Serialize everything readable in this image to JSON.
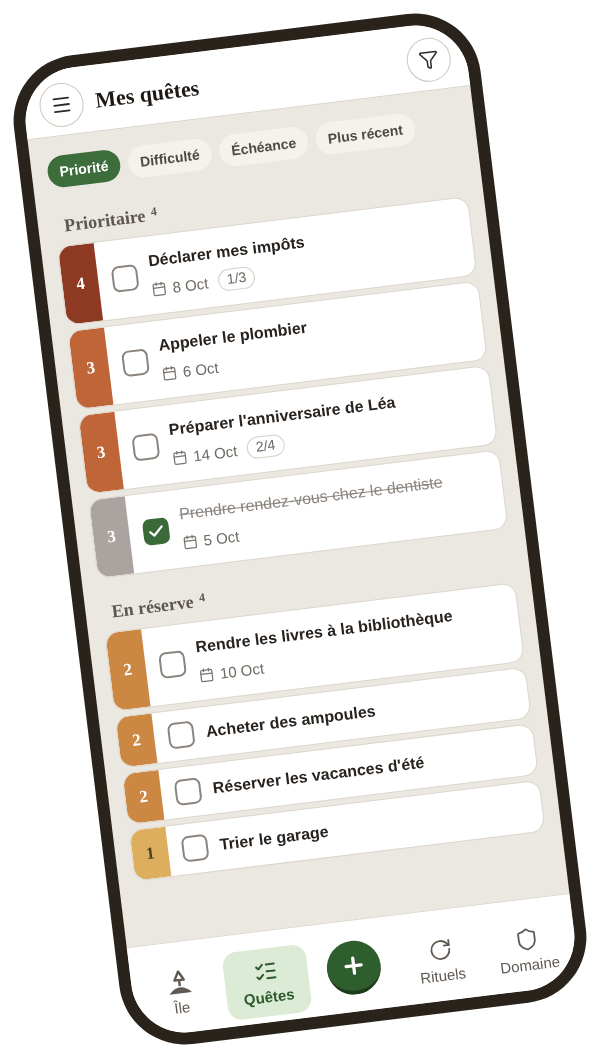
{
  "header": {
    "title": "Mes quêtes"
  },
  "sort_chips": [
    {
      "label": "Priorité",
      "selected": true
    },
    {
      "label": "Difficulté",
      "selected": false
    },
    {
      "label": "Échéance",
      "selected": false
    },
    {
      "label": "Plus récent",
      "selected": false
    }
  ],
  "sections": [
    {
      "title": "Prioritaire",
      "count": "4",
      "quests": [
        {
          "priority": "4",
          "color": "#8e3a22",
          "title": "Déclarer mes impôts",
          "done": false,
          "date": "8 Oct",
          "subtasks": "1/3"
        },
        {
          "priority": "3",
          "color": "#c06537",
          "title": "Appeler le plombier",
          "done": false,
          "date": "6 Oct"
        },
        {
          "priority": "3",
          "color": "#c06537",
          "title": "Préparer l'anniversaire de Léa",
          "done": false,
          "date": "14 Oct",
          "subtasks": "2/4"
        },
        {
          "priority": "3",
          "color": "#aaa3a0",
          "title": "Prendre rendez-vous chez le dentiste",
          "done": true,
          "date": "5 Oct"
        }
      ]
    },
    {
      "title": "En réserve",
      "count": "4",
      "quests": [
        {
          "priority": "2",
          "color": "#cc8743",
          "title": "Rendre les livres à la bibliothèque",
          "done": false,
          "date": "10 Oct"
        },
        {
          "priority": "2",
          "color": "#cc8743",
          "title": "Acheter des ampoules",
          "done": false
        },
        {
          "priority": "2",
          "color": "#cc8743",
          "title": "Réserver les vacances d'été",
          "done": false
        },
        {
          "priority": "1",
          "color": "#dcae5e",
          "title": "Trier le garage",
          "done": false
        }
      ]
    }
  ],
  "nav": [
    {
      "kind": "island",
      "label": "Île",
      "selected": false
    },
    {
      "kind": "quests",
      "label": "Quêtes",
      "selected": true
    },
    {
      "kind": "add",
      "selected": false
    },
    {
      "kind": "rituals",
      "label": "Rituels",
      "selected": false
    },
    {
      "kind": "domain",
      "label": "Domaine",
      "selected": false
    }
  ]
}
